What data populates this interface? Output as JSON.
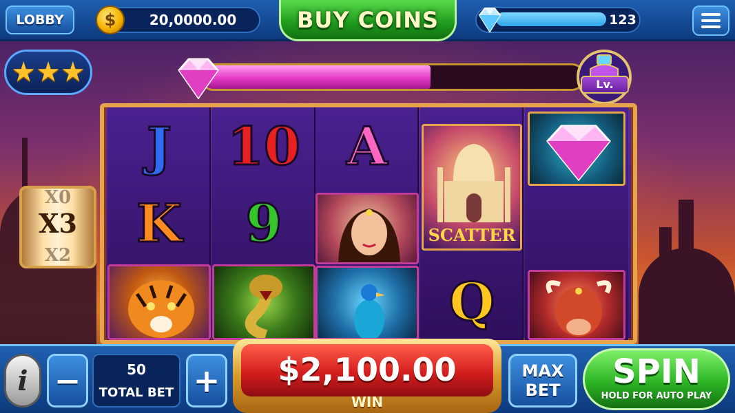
{
  "topbar": {
    "lobby_label": "LOBBY",
    "coin_symbol": "$",
    "coin_balance": "20,0000.00",
    "buy_coins_label": "BUY COINS",
    "gem_count": "123",
    "gem_fill_fraction": 0.85,
    "menu_icon": "hamburger-menu-icon"
  },
  "level": {
    "progress_fraction": 0.6,
    "badge_label": "Lv."
  },
  "rating": {
    "stars": 3,
    "star_glyphs": "★★★"
  },
  "multiplier": {
    "current": "X3",
    "above": "X0",
    "below": "X2"
  },
  "reels": {
    "reel1": [
      "J",
      "K",
      "tiger"
    ],
    "reel2": [
      "10",
      "9",
      "cobra"
    ],
    "reel3": [
      "A",
      "princess",
      "peacock"
    ],
    "reel4": [
      "taj-mahal-scatter",
      "Q"
    ],
    "reel5": [
      "diamond",
      "empty",
      "bull"
    ],
    "scatter_label": "SCATTER"
  },
  "bet": {
    "value": "50",
    "label": "TOTAL BET",
    "minus_label": "−",
    "plus_label": "+"
  },
  "win": {
    "amount": "$2,100.00",
    "label": "WIN"
  },
  "controls": {
    "info_label": "i",
    "max_bet_line1": "MAX",
    "max_bet_line2": "BET",
    "spin_label": "SPIN",
    "spin_sub": "HOLD FOR AUTO PLAY"
  },
  "colors": {
    "accent_blue": "#1f5fb0",
    "buy_green": "#1f9a1c",
    "win_red": "#d41e1e",
    "level_pink": "#e63bc8",
    "gold": "#e6a54a"
  }
}
